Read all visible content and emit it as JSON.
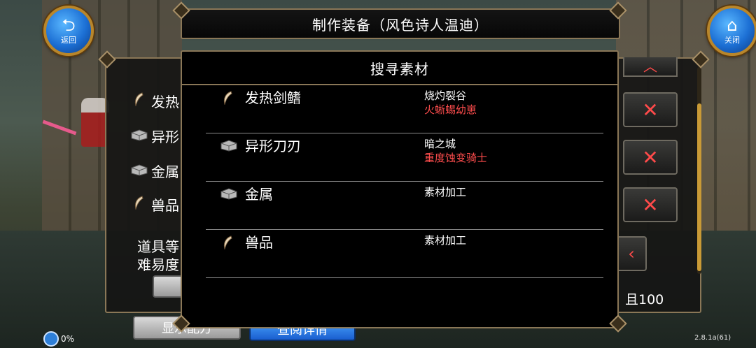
{
  "hud": {
    "back_label": "返回",
    "close_label": "关闭"
  },
  "title": "制作装备（风色诗人温迪）",
  "background_panel": {
    "rows": [
      {
        "label": "发热",
        "icon": "claw-icon"
      },
      {
        "label": "异形",
        "icon": "metal-box-icon"
      },
      {
        "label": "金属",
        "icon": "metal-box-icon"
      },
      {
        "label": "兽品",
        "icon": "claw-icon"
      }
    ],
    "info_line1": "道具等",
    "info_line2": "难易度",
    "note": "，且100",
    "show_button": "显示配方",
    "detail_button": "查阅详情",
    "remove_icon": "✕",
    "up_icon": "︿",
    "left_icon": "‹"
  },
  "popup": {
    "title": "搜寻素材",
    "items": [
      {
        "name": "发热剑鳍",
        "icon": "claw-icon",
        "source": "烧灼裂谷",
        "monster": "火蜥蜴幼崽"
      },
      {
        "name": "异形刀刃",
        "icon": "metal-box-icon",
        "source": "暗之城",
        "monster": "重度蚀变骑士"
      },
      {
        "name": "金属",
        "icon": "metal-box-icon",
        "source": "素材加工",
        "monster": ""
      },
      {
        "name": "兽品",
        "icon": "claw-icon",
        "source": "素材加工",
        "monster": ""
      }
    ]
  },
  "status": {
    "percent": "0%",
    "version": "2.8.1a(61)"
  },
  "colors": {
    "accent_gold": "#8a7757",
    "monster_red": "#ff4d4d",
    "hud_blue": "#1c6fd4"
  }
}
